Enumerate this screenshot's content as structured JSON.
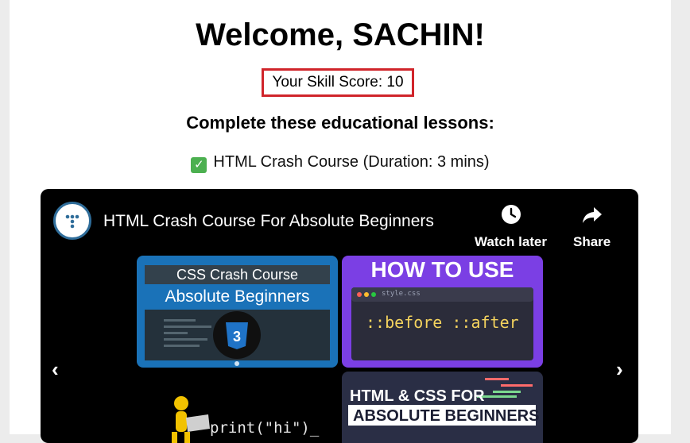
{
  "header": {
    "welcome": "Welcome, SACHIN!",
    "score": "Your Skill Score: 10",
    "subtitle": "Complete these educational lessons:"
  },
  "lesson": {
    "check_icon": "check-mark-icon",
    "text": "HTML Crash Course (Duration: 3 mins)"
  },
  "video": {
    "title": "HTML Crash Course For Absolute Beginners",
    "watch_later": "Watch later",
    "share": "Share",
    "prev_icon": "chevron-left-icon",
    "next_icon": "chevron-right-icon",
    "thumbnails": [
      {
        "line1": "CSS Crash Course",
        "line2": "Absolute Beginners"
      },
      {
        "heading": "HOW TO USE",
        "file": "style.css",
        "code": "::before ::after"
      },
      {
        "code": "print(\"hi\")_"
      },
      {
        "line1": "HTML & CSS FOR",
        "line2": "ABSOLUTE BEGINNERS"
      }
    ]
  },
  "colors": {
    "score_border": "#d0242a",
    "check": "#4cb050",
    "video_bg": "#000000"
  }
}
